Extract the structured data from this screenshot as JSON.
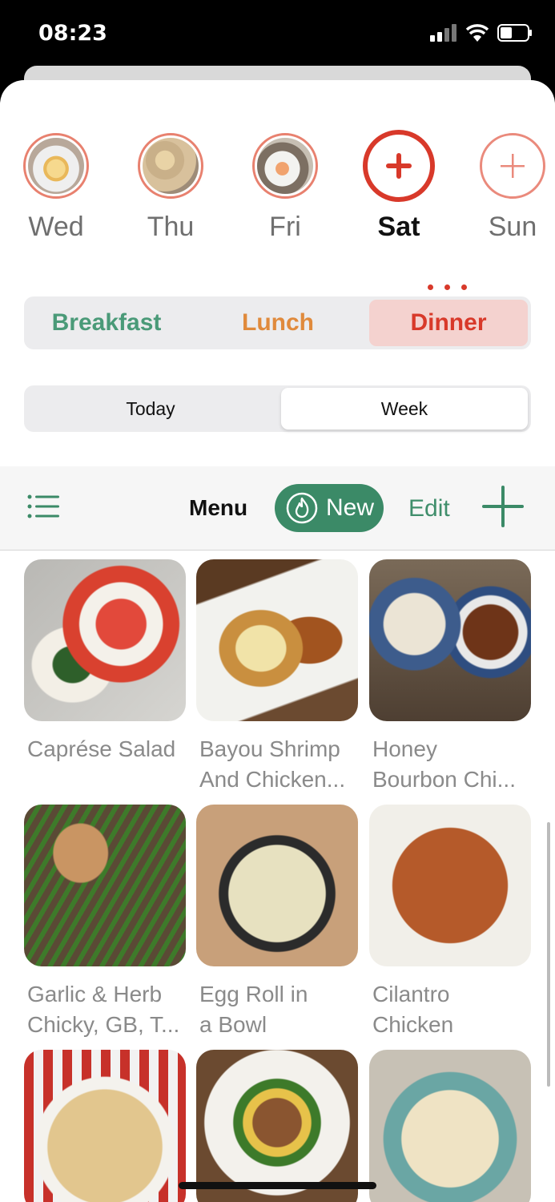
{
  "status": {
    "time": "08:23"
  },
  "days": [
    {
      "label": "Wed",
      "kind": "photo"
    },
    {
      "label": "Thu",
      "kind": "photo"
    },
    {
      "label": "Fri",
      "kind": "photo"
    },
    {
      "label": "Sat",
      "kind": "add",
      "selected": true
    },
    {
      "label": "Sun",
      "kind": "add"
    }
  ],
  "meals": {
    "breakfast": "Breakfast",
    "lunch": "Lunch",
    "dinner": "Dinner",
    "selected": "Dinner"
  },
  "range": {
    "today": "Today",
    "week": "Week",
    "selected": "Week"
  },
  "toolbar": {
    "title": "Menu",
    "new_label": "New",
    "edit_label": "Edit"
  },
  "recipes": [
    {
      "title": "Caprése Salad"
    },
    {
      "title": "Bayou Shrimp\nAnd Chicken..."
    },
    {
      "title": "Honey\nBourbon Chi..."
    },
    {
      "title": "Garlic & Herb\nChicky, GB, T..."
    },
    {
      "title": "Egg Roll in\na Bowl"
    },
    {
      "title": "Cilantro\nChicken"
    },
    {
      "title": ""
    },
    {
      "title": ""
    },
    {
      "title": ""
    }
  ],
  "colors": {
    "accent_red": "#d8392a",
    "accent_green": "#3b8a67",
    "lunch": "#e08a3c",
    "breakfast": "#4a9a78"
  }
}
